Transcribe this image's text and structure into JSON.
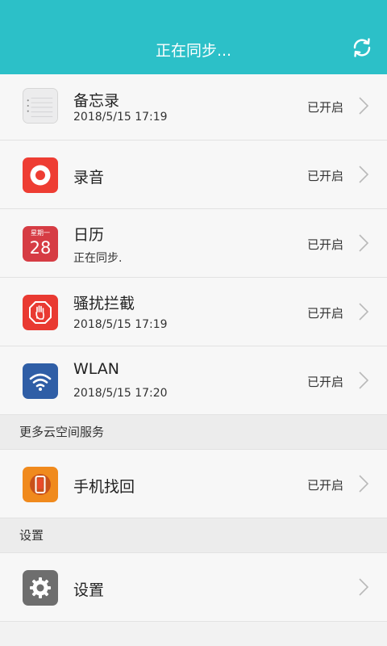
{
  "header": {
    "title": "正在同步..."
  },
  "rows": [
    {
      "title": "备忘录",
      "subtitle": "2018/5/15 17:19",
      "status": "已开启",
      "icon": "notes-icon"
    },
    {
      "title": "录音",
      "subtitle": "",
      "status": "已开启",
      "icon": "recorder-icon"
    },
    {
      "title": "日历",
      "subtitle": "正在同步.",
      "status": "已开启",
      "icon": "calendar-icon",
      "calendar_weekday": "星期一",
      "calendar_day": "28"
    },
    {
      "title": "骚扰拦截",
      "subtitle": "2018/5/15 17:19",
      "status": "已开启",
      "icon": "block-icon"
    },
    {
      "title": "WLAN",
      "subtitle": "2018/5/15 17:20",
      "status": "已开启",
      "icon": "wifi-icon"
    }
  ],
  "section_more": {
    "label": "更多云空间服务"
  },
  "find_phone": {
    "title": "手机找回",
    "status": "已开启",
    "icon": "phone-find-icon"
  },
  "section_settings": {
    "label": "设置"
  },
  "settings": {
    "title": "设置",
    "icon": "gear-icon"
  },
  "colors": {
    "header": "#2cc0c8",
    "notes": "#e9e9ea",
    "recorder": "#ee3d33",
    "calendar": "#d63c44",
    "block": "#e93a32",
    "wifi": "#2f5ea6",
    "find_phone": "#f08a1d",
    "gear": "#6e6e6e"
  }
}
